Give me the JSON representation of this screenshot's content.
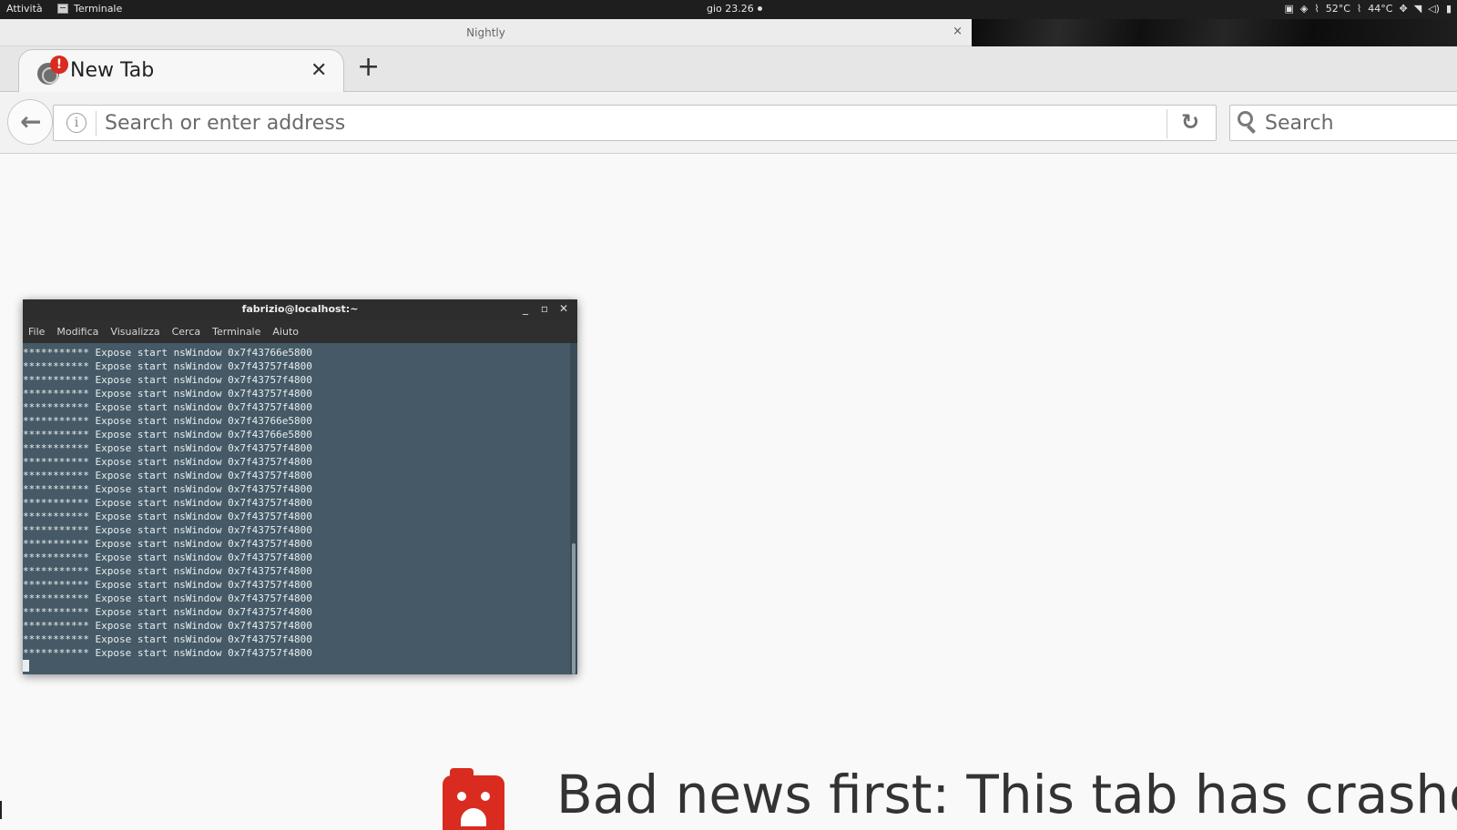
{
  "topbar": {
    "activities": "Attività",
    "app_name": "Terminale",
    "clock": "gio 23.26",
    "temp1": "52°C",
    "temp2": "44°C"
  },
  "window": {
    "title": "Nightly",
    "close": "×"
  },
  "tabs": {
    "active_label": "New Tab",
    "close_glyph": "✕",
    "new_tab_glyph": "+",
    "crash_badge": "!"
  },
  "navbar": {
    "back_glyph": "🡐",
    "info_glyph": "i",
    "url_placeholder": "Search or enter address",
    "reload_glyph": "↻",
    "search_placeholder": "Search"
  },
  "terminal": {
    "title": "fabrizio@localhost:~",
    "controls": [
      "_",
      "▫",
      "✕"
    ],
    "menu": [
      "File",
      "Modifica",
      "Visualizza",
      "Cerca",
      "Terminale",
      "Aiuto"
    ],
    "lines": [
      "*********** Expose start nsWindow 0x7f43766e5800",
      "*********** Expose start nsWindow 0x7f43757f4800",
      "*********** Expose start nsWindow 0x7f43757f4800",
      "*********** Expose start nsWindow 0x7f43757f4800",
      "*********** Expose start nsWindow 0x7f43757f4800",
      "*********** Expose start nsWindow 0x7f43766e5800",
      "*********** Expose start nsWindow 0x7f43766e5800",
      "*********** Expose start nsWindow 0x7f43757f4800",
      "*********** Expose start nsWindow 0x7f43757f4800",
      "*********** Expose start nsWindow 0x7f43757f4800",
      "*********** Expose start nsWindow 0x7f43757f4800",
      "*********** Expose start nsWindow 0x7f43757f4800",
      "*********** Expose start nsWindow 0x7f43757f4800",
      "*********** Expose start nsWindow 0x7f43757f4800",
      "*********** Expose start nsWindow 0x7f43757f4800",
      "*********** Expose start nsWindow 0x7f43757f4800",
      "*********** Expose start nsWindow 0x7f43757f4800",
      "*********** Expose start nsWindow 0x7f43757f4800",
      "*********** Expose start nsWindow 0x7f43757f4800",
      "*********** Expose start nsWindow 0x7f43757f4800",
      "*********** Expose start nsWindow 0x7f43757f4800",
      "*********** Expose start nsWindow 0x7f43757f4800",
      "*********** Expose start nsWindow 0x7f43757f4800"
    ]
  },
  "crash_page": {
    "title": "Bad news first: This tab has crashed"
  },
  "colors": {
    "terminal_bg": "#455a66",
    "crash_red": "#d92b1f",
    "topbar_bg": "#1e1e1e"
  },
  "icons": {
    "tray": [
      "screen-icon",
      "dropbox-icon",
      "thermometer-icon",
      "thermometer-icon",
      "network-icon",
      "wifi-icon",
      "volume-icon",
      "battery-icon"
    ]
  }
}
